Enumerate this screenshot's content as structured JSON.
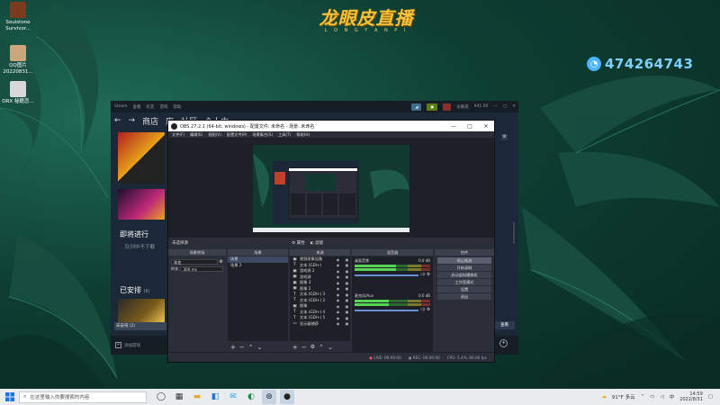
{
  "desktop": {
    "brand_title": "龙眼皮直播",
    "brand_subtitle": "L O N G Y A N P I",
    "qq_number": "474264743",
    "icons": [
      {
        "label": "Soulstone Survivor..."
      },
      {
        "label": "QQ图片 20220831..."
      },
      {
        "label": "ORX 秘籍恋..."
      }
    ]
  },
  "steam": {
    "menu": [
      "Steam",
      "查看",
      "好友",
      "游戏",
      "帮助"
    ],
    "nav": {
      "back": "←",
      "forward": "→",
      "store": "商店",
      "library": "库",
      "community": "社区",
      "profile": "个人中"
    },
    "user": "龙眼皮",
    "balance": "¥41.00",
    "sections": [
      {
        "label": "即将进行",
        "sub": "队列中不下载"
      },
      {
        "label": "已安排",
        "count": "(6)"
      }
    ],
    "install_label": "未安排 (2)",
    "add_game": "添加游戏",
    "right_btn": "查看"
  },
  "obs": {
    "title": "OBS 27.2.1 (64-bit, windows) - 配置文件: 未命名 - 场景: 未命名",
    "menu": [
      "文件(F)",
      "编辑(E)",
      "视图(V)",
      "配置文件(P)",
      "场景集合(S)",
      "工具(T)",
      "帮助(H)"
    ],
    "no_source": "未选择源",
    "props_btn": "属性",
    "filters_btn": "滤镜",
    "docks": {
      "transitions": "场景转场",
      "scenes": "场景",
      "sources": "来源",
      "mixer": "混音器",
      "controls": "控件"
    },
    "transition": {
      "type": "渐变",
      "duration_label": "时长",
      "duration": "300 ms"
    },
    "scenes": [
      "场景",
      "场景 2"
    ],
    "sources": [
      {
        "icon": "▣",
        "label": "视频采集设备"
      },
      {
        "icon": "T",
        "label": "文本 (GDI+)"
      },
      {
        "icon": "▣",
        "label": "游戏源 2"
      },
      {
        "icon": "▣",
        "label": "游戏源"
      },
      {
        "icon": "▣",
        "label": "图像 3"
      },
      {
        "icon": "▣",
        "label": "图像 2"
      },
      {
        "icon": "T",
        "label": "文本 (GDI+) 3"
      },
      {
        "icon": "T",
        "label": "文本 (GDI+) 2"
      },
      {
        "icon": "▣",
        "label": "图像"
      },
      {
        "icon": "T",
        "label": "文本 (GDI+) 4"
      },
      {
        "icon": "T",
        "label": "文本 (GDI+) 5"
      },
      {
        "icon": "▭",
        "label": "显示器捕获"
      }
    ],
    "mixer": [
      {
        "name": "桌面音频",
        "db": "0.0 dB",
        "level": 0.55
      },
      {
        "name": "麦克风/Aux",
        "db": "0.0 dB",
        "level": 0.45
      }
    ],
    "controls": [
      "停止推流",
      "开始录制",
      "启动虚拟摄像机",
      "工作室模式",
      "设置",
      "退出"
    ],
    "status": {
      "live": "LIVE: 00:00:00",
      "rec": "REC: 00:00:00",
      "cpu": "CPU: 5.4%, 60.00 fps"
    }
  },
  "taskbar": {
    "search_placeholder": "在这里输入你要搜索的内容",
    "weather": "91°F 多云",
    "time": "14:59",
    "date": "2022/8/31"
  }
}
